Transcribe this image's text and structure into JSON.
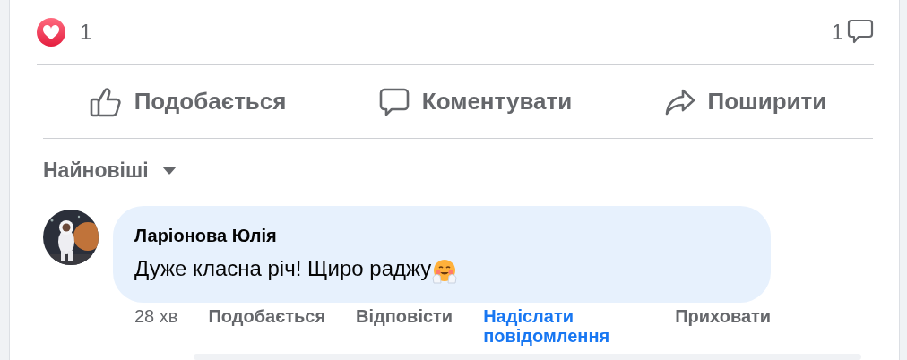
{
  "reactions": {
    "count": "1",
    "comments_count": "1"
  },
  "actions": [
    {
      "kind": "like",
      "label": "Подобається"
    },
    {
      "kind": "comment",
      "label": "Коментувати"
    },
    {
      "kind": "share",
      "label": "Поширити"
    }
  ],
  "sort": {
    "label": "Найновіші"
  },
  "comments": [
    {
      "author": "Ларіонова Юлія",
      "text": "Дуже класна річ! Щиро раджу",
      "time": "28 хв",
      "links": [
        {
          "kind": "plain",
          "label": "Подобається"
        },
        {
          "kind": "plain",
          "label": "Відповісти"
        },
        {
          "kind": "accent",
          "label": "Надіслати повідомлення"
        },
        {
          "kind": "plain",
          "label": "Приховати"
        }
      ]
    }
  ]
}
